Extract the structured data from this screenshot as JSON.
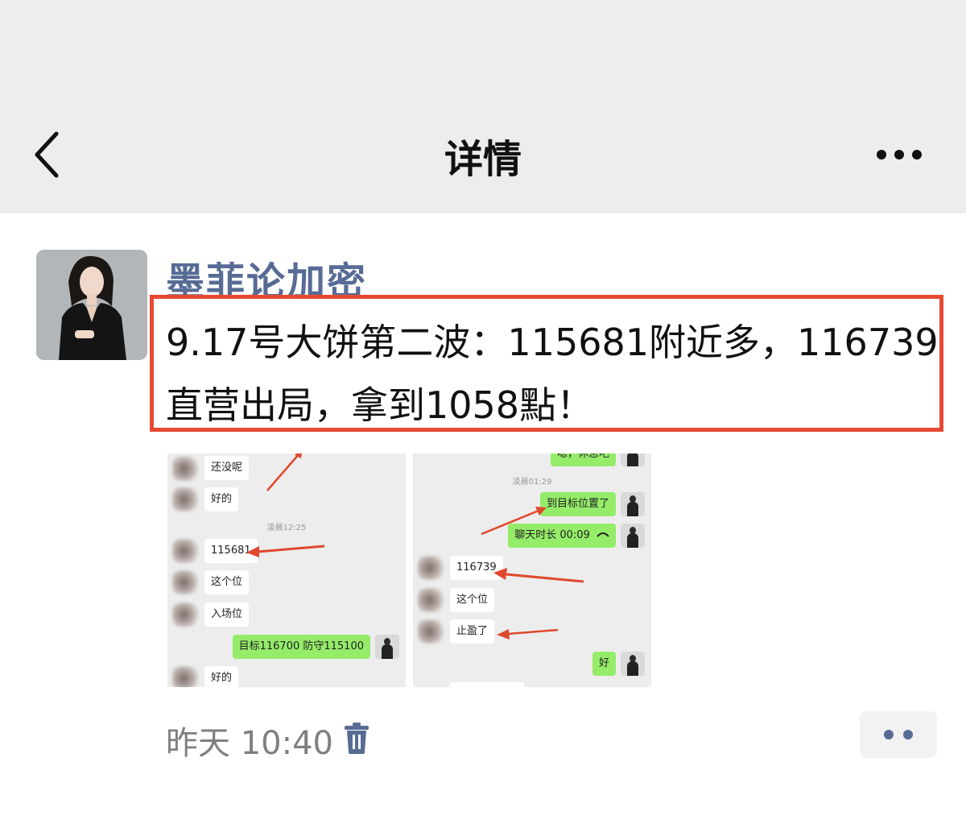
{
  "header": {
    "title": "详情"
  },
  "post": {
    "username": "墨菲论加密",
    "text_lines": [
      "9.17号大饼第二波：115681附近多，116739",
      "直营出局，拿到1058點！"
    ],
    "time": "昨天 10:40"
  },
  "screenshot1": {
    "timestamp": "凌晨12:25",
    "messages": [
      {
        "side": "left",
        "text": "还没呢"
      },
      {
        "side": "left",
        "text": "好的"
      },
      {
        "side": "left",
        "text": "115681"
      },
      {
        "side": "left",
        "text": "这个位"
      },
      {
        "side": "left",
        "text": "入场位"
      },
      {
        "side": "right",
        "text": "目标116700 防守115100"
      },
      {
        "side": "left",
        "text": "好的"
      }
    ]
  },
  "screenshot2": {
    "timestamp": "凌晨01:29",
    "messages": [
      {
        "side": "right",
        "text": "嗯，休息吧"
      },
      {
        "side": "right",
        "text": "到目标位置了"
      },
      {
        "side": "right",
        "text": "聊天时长 00:09"
      },
      {
        "side": "left",
        "text": "116739"
      },
      {
        "side": "left",
        "text": "这个位"
      },
      {
        "side": "left",
        "text": "止盈了"
      },
      {
        "side": "right",
        "text": "好"
      }
    ]
  },
  "colors": {
    "username": "#576b95",
    "highlight_border": "#e84a34",
    "bubble_right": "#95ec69",
    "arrow": "#e0482e"
  }
}
